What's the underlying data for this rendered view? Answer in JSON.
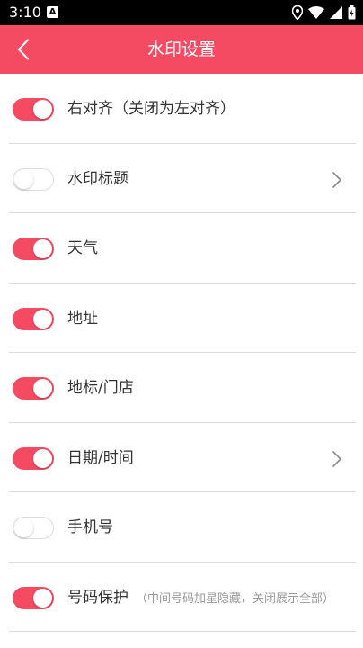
{
  "status_bar": {
    "time": "3:10",
    "notification_letter": "A"
  },
  "app_bar": {
    "title": "水印设置",
    "color": "#f44b62"
  },
  "settings": [
    {
      "label": "右对齐（关闭为左对齐）",
      "hint": "",
      "enabled": true,
      "has_arrow": false
    },
    {
      "label": "水印标题",
      "hint": "",
      "enabled": false,
      "has_arrow": true
    },
    {
      "label": "天气",
      "hint": "",
      "enabled": true,
      "has_arrow": false
    },
    {
      "label": "地址",
      "hint": "",
      "enabled": true,
      "has_arrow": false
    },
    {
      "label": "地标/门店",
      "hint": "",
      "enabled": true,
      "has_arrow": false
    },
    {
      "label": "日期/时间",
      "hint": "",
      "enabled": true,
      "has_arrow": true
    },
    {
      "label": "手机号",
      "hint": "",
      "enabled": false,
      "has_arrow": false
    },
    {
      "label": "号码保护",
      "hint": "（中间号码加星隐藏，关闭展示全部）",
      "enabled": true,
      "has_arrow": false
    }
  ]
}
